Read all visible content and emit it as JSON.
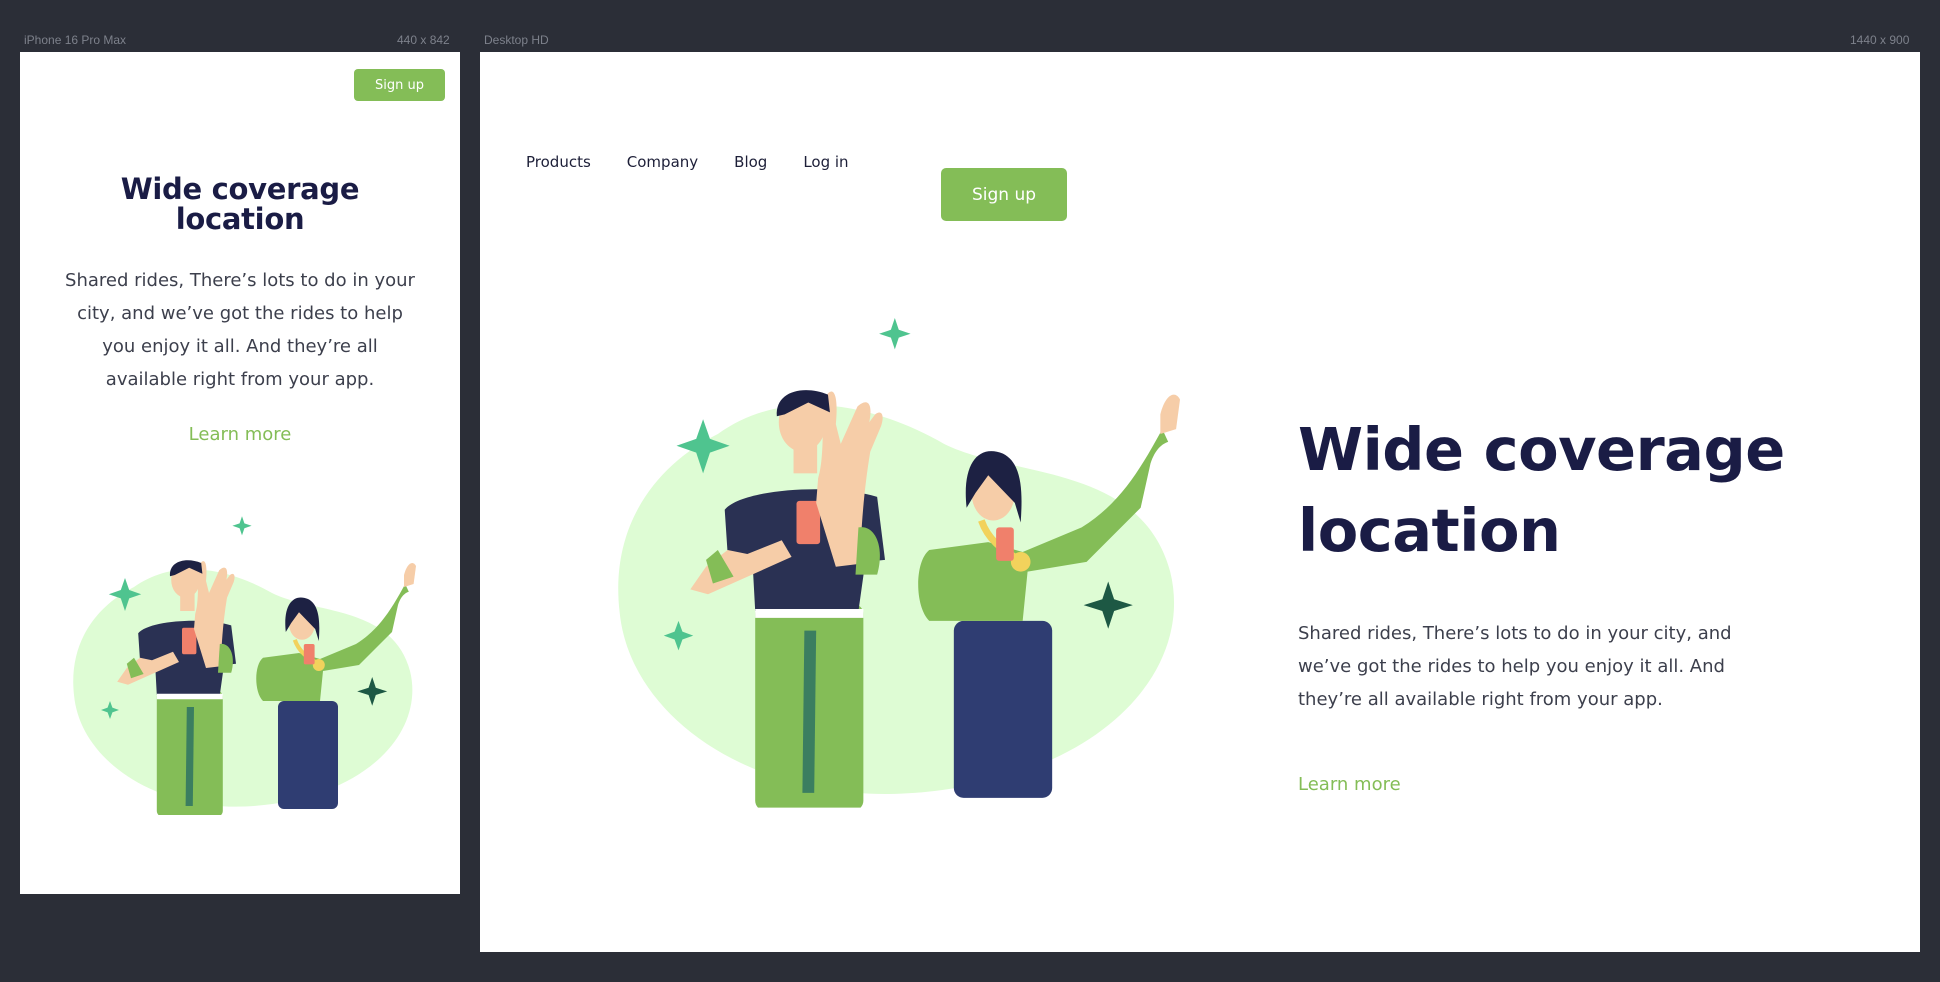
{
  "mobile_frame": {
    "label": "iPhone 16 Pro Max",
    "size": "440 x 842"
  },
  "desktop_frame": {
    "label": "Desktop HD",
    "size": "1440 x 900"
  },
  "nav": {
    "items": [
      "Products",
      "Company",
      "Blog",
      "Log in"
    ],
    "signup": "Sign up"
  },
  "hero": {
    "title": "Wide coverage location",
    "description": "Shared rides, There’s lots to do in your city, and we’ve got the rides to help you enjoy it all. And they’re all available right from your app.",
    "cta": "Learn more"
  },
  "colors": {
    "background": "#2b2e37",
    "accent": "#84bd57",
    "title": "#1a1c45",
    "blob": "#defcd4"
  }
}
